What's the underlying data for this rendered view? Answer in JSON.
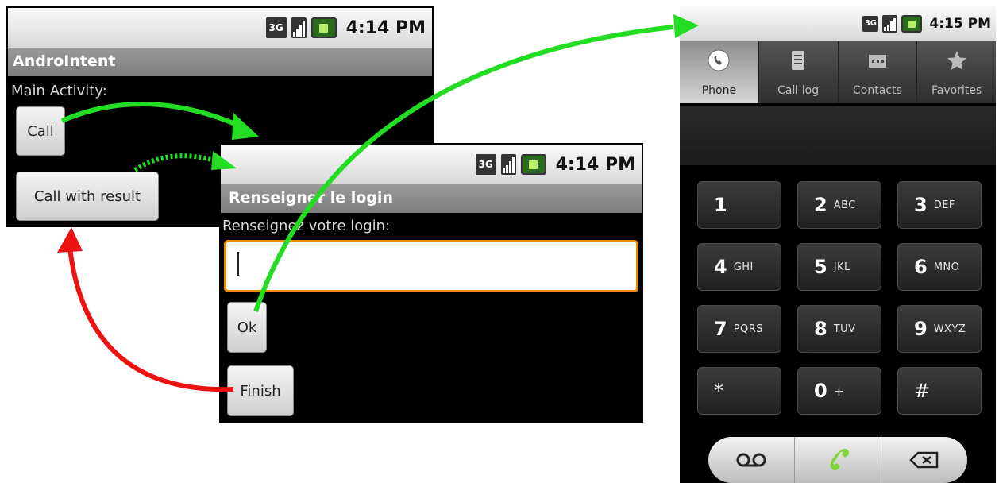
{
  "screen1": {
    "clock": "4:14 PM",
    "network": "3G",
    "title": "AndroIntent",
    "label": "Main Activity:",
    "button_call": "Call",
    "button_call_result": "Call with result"
  },
  "screen2": {
    "clock": "4:14 PM",
    "network": "3G",
    "title": "Renseigner le login",
    "label": "Renseignez votre login:",
    "input_value": "",
    "button_ok": "Ok",
    "button_finish": "Finish"
  },
  "screen3": {
    "clock": "4:15 PM",
    "network": "3G",
    "tabs": [
      {
        "label": "Phone",
        "icon": "phone-icon"
      },
      {
        "label": "Call log",
        "icon": "call-log-icon"
      },
      {
        "label": "Contacts",
        "icon": "contacts-icon"
      },
      {
        "label": "Favorites",
        "icon": "star-icon"
      }
    ],
    "keys": [
      {
        "digit": "1",
        "letters": ""
      },
      {
        "digit": "2",
        "letters": "ABC"
      },
      {
        "digit": "3",
        "letters": "DEF"
      },
      {
        "digit": "4",
        "letters": "GHI"
      },
      {
        "digit": "5",
        "letters": "JKL"
      },
      {
        "digit": "6",
        "letters": "MNO"
      },
      {
        "digit": "7",
        "letters": "PQRS"
      },
      {
        "digit": "8",
        "letters": "TUV"
      },
      {
        "digit": "9",
        "letters": "WXYZ"
      },
      {
        "digit": "*",
        "letters": ""
      },
      {
        "digit": "0",
        "letters": "+"
      },
      {
        "digit": "#",
        "letters": ""
      }
    ],
    "bottom": {
      "voicemail_icon": "voicemail-icon",
      "call_icon": "call-icon",
      "backspace_icon": "backspace-icon"
    }
  },
  "colors": {
    "arrow_green": "#22dd22",
    "arrow_red": "#ee1111",
    "focus_orange": "#f08a00"
  }
}
